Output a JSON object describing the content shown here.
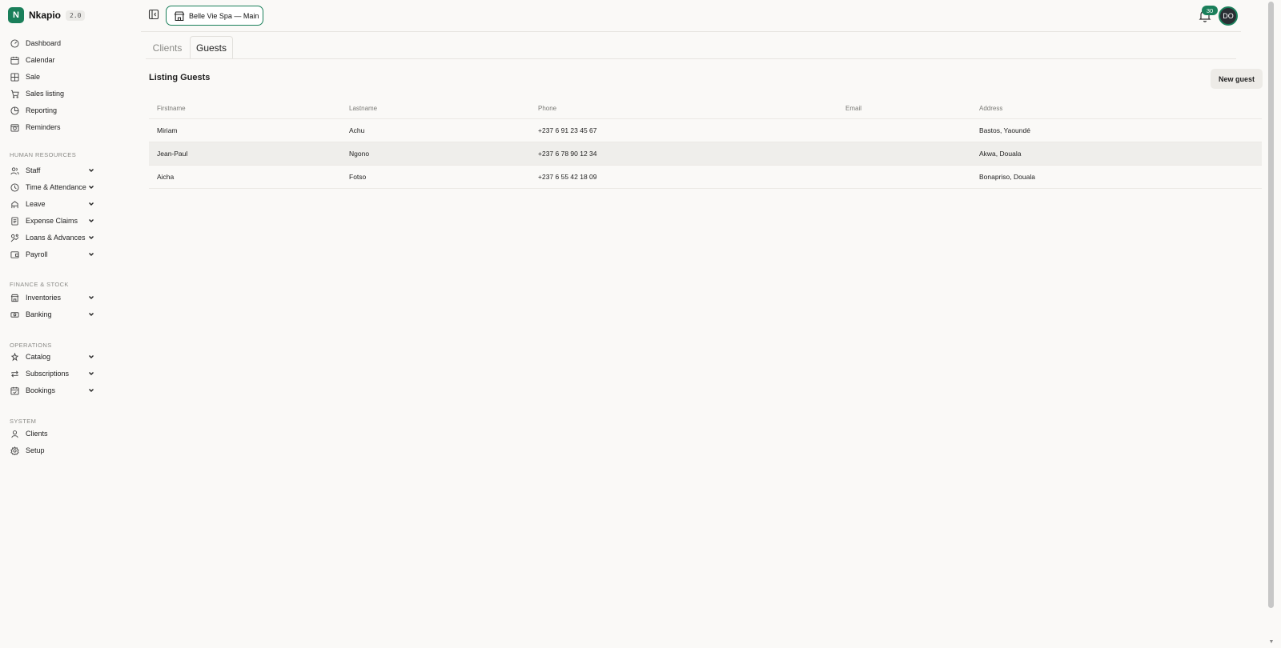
{
  "app": {
    "name": "Nkapio",
    "version": "2.0",
    "logo_letter": "N",
    "accent_color": "#1a7f5a"
  },
  "sidebar": {
    "top_items": [
      {
        "label": "Dashboard",
        "icon": "dashboard-icon"
      },
      {
        "label": "Calendar",
        "icon": "calendar-icon"
      },
      {
        "label": "Sale",
        "icon": "grid-icon"
      },
      {
        "label": "Sales listing",
        "icon": "cart-icon"
      },
      {
        "label": "Reporting",
        "icon": "pie-chart-icon"
      },
      {
        "label": "Reminders",
        "icon": "reminder-icon"
      }
    ],
    "sections": [
      {
        "title": "HUMAN RESOURCES",
        "items": [
          {
            "label": "Staff",
            "icon": "users-icon"
          },
          {
            "label": "Time & Attendance",
            "icon": "clock-icon"
          },
          {
            "label": "Leave",
            "icon": "leave-icon"
          },
          {
            "label": "Expense Claims",
            "icon": "receipt-icon"
          },
          {
            "label": "Loans & Advances",
            "icon": "loans-icon"
          },
          {
            "label": "Payroll",
            "icon": "wallet-icon"
          }
        ]
      },
      {
        "title": "FINANCE & STOCK",
        "items": [
          {
            "label": "Inventories",
            "icon": "store-icon"
          },
          {
            "label": "Banking",
            "icon": "banknote-icon"
          }
        ]
      },
      {
        "title": "OPERATIONS",
        "items": [
          {
            "label": "Catalog",
            "icon": "catalog-icon"
          },
          {
            "label": "Subscriptions",
            "icon": "repeat-icon"
          },
          {
            "label": "Bookings",
            "icon": "calendar-check-icon"
          }
        ]
      },
      {
        "title": "SYSTEM",
        "items": [
          {
            "label": "Clients",
            "icon": "user-icon"
          },
          {
            "label": "Setup",
            "icon": "settings-icon"
          }
        ]
      }
    ]
  },
  "topbar": {
    "store_label": "Belle Vie Spa — Main",
    "notification_count": "30",
    "avatar_initials": "DO"
  },
  "tabs": {
    "clients": "Clients",
    "guests": "Guests"
  },
  "main": {
    "title": "Listing Guests",
    "new_button": "New guest",
    "columns": [
      "Firstname",
      "Lastname",
      "Phone",
      "Email",
      "Address"
    ],
    "rows": [
      {
        "firstname": "Miriam",
        "lastname": "Achu",
        "phone": "+237 6 91 23 45 67",
        "email": "",
        "address": "Bastos, Yaoundé"
      },
      {
        "firstname": "Jean-Paul",
        "lastname": "Ngono",
        "phone": "+237 6 78 90 12 34",
        "email": "",
        "address": "Akwa, Douala"
      },
      {
        "firstname": "Aicha",
        "lastname": "Fotso",
        "phone": "+237 6 55 42 18 09",
        "email": "",
        "address": "Bonapriso, Douala"
      }
    ]
  }
}
